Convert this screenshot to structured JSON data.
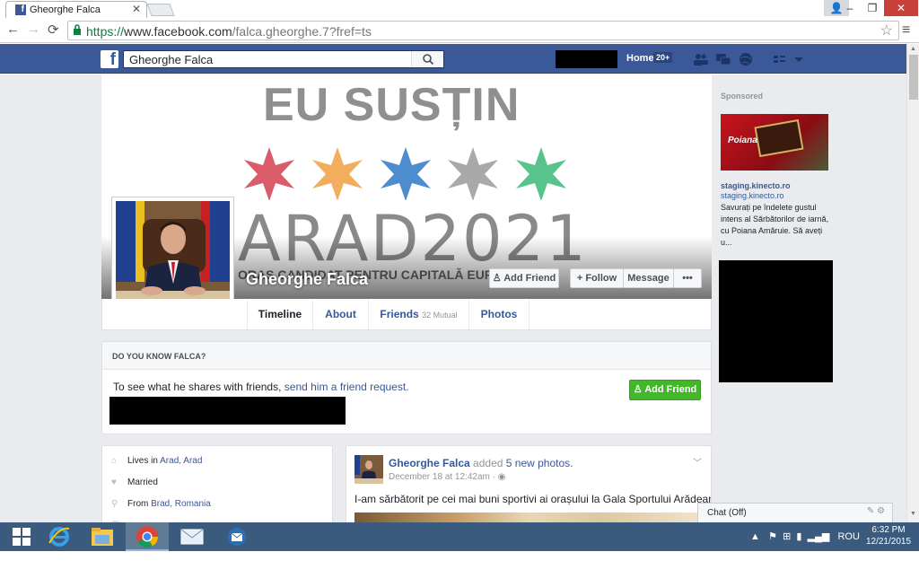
{
  "browser": {
    "tab_title": "Gheorghe Falca",
    "url_scheme": "https://",
    "url_host": "www.facebook.com",
    "url_path": "/falca.gheorghe.7?fref=ts"
  },
  "fb_header": {
    "search_value": "Gheorghe Falca",
    "home_label": "Home",
    "home_badge": "20+"
  },
  "cover": {
    "headline": "EU SUSȚIN",
    "city": "ARAD2021",
    "subline": "ORAȘ CANDIDAT PENTRU CAPITALĂ EUROPEANĂ",
    "profile_name": "Gheorghe Falca",
    "buttons": {
      "add_friend": "Add Friend",
      "follow": "Follow",
      "message": "Message",
      "more": "•••"
    }
  },
  "profile_tabs": {
    "timeline": "Timeline",
    "about": "About",
    "friends": "Friends",
    "friends_mutual": "32 Mutual",
    "photos": "Photos"
  },
  "do_you_know": {
    "title": "DO YOU KNOW FALCA?",
    "text_prefix": "To see what he shares with friends,",
    "text_link": "send him a friend request.",
    "button": "Add Friend"
  },
  "intro": {
    "lives_prefix": "Lives in",
    "lives_link": "Arad, Arad",
    "relationship": "Married",
    "from_prefix": "From",
    "from_link": "Brad, Romania"
  },
  "post": {
    "author": "Gheorghe Falca",
    "action": "added",
    "action_link": "5 new photos.",
    "date": "December 18 at 12:42am · ",
    "text": "I-am sărbătorit pe cei mai buni sportivi ai orașului la Gala Sportului Arădean."
  },
  "sidebar": {
    "sponsored_label": "Sponsored",
    "ad_brand": "Poiana",
    "ad_title": "staging.kinecto.ro",
    "ad_domain": "staging.kinecto.ro",
    "ad_body": "Savurați pe îndelete gustul intens al Sărbătorilor de iarnă, cu Poiana Amăruie. Să aveți u..."
  },
  "chat": {
    "label": "Chat (Off)"
  },
  "taskbar": {
    "language": "ROU",
    "time": "6:32 PM",
    "date": "12/21/2015"
  },
  "colors": {
    "fb_blue": "#3b5998",
    "link": "#365899",
    "green_button": "#42b72a",
    "taskbar": "#3a5a7e"
  }
}
